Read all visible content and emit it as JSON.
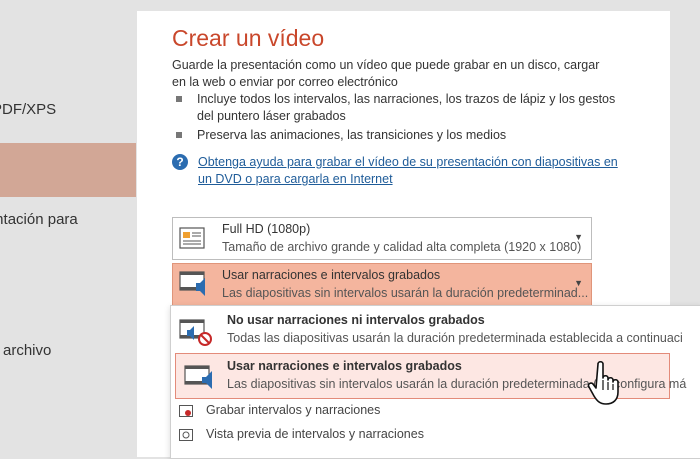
{
  "nav": {
    "items": [
      {
        "label": "PDF/XPS"
      },
      {
        "label": "Presentación para"
      },
      {
        "label": "archivo"
      }
    ]
  },
  "panel": {
    "title": "Crear un vídeo",
    "description": "Guarde la presentación como un vídeo que puede grabar en un disco, cargar en la web o enviar por correo electrónico",
    "bullets": [
      "Incluye todos los intervalos, las narraciones, los trazos de lápiz y los gestos del puntero láser grabados",
      "Preserva las animaciones, las transiciones y los medios"
    ],
    "help_link": "Obtenga ayuda para grabar el vídeo de su presentación con diapositivas en un DVD o para cargarla en Internet"
  },
  "quality_dropdown": {
    "title": "Full HD (1080p)",
    "subtitle": "Tamaño de archivo grande y calidad alta completa (1920 x 1080)"
  },
  "narration_dropdown": {
    "title": "Usar narraciones e intervalos grabados",
    "subtitle": "Las diapositivas sin intervalos usarán la duración predeterminad..."
  },
  "narration_options": [
    {
      "title": "No usar narraciones ni intervalos grabados",
      "subtitle": "Todas las diapositivas usarán la duración predeterminada establecida a continuaci"
    },
    {
      "title": "Usar narraciones e intervalos grabados",
      "subtitle": "Las diapositivas sin intervalos usarán la duración predeterminada (se configura má"
    }
  ],
  "narration_actions": [
    {
      "label": "Grabar intervalos y narraciones"
    },
    {
      "label": "Vista previa de intervalos y narraciones"
    }
  ],
  "colors": {
    "accent": "#c9472b",
    "nav_active": "#d2a796",
    "dropdown_highlight": "#f4b59e",
    "link": "#1f5c99"
  }
}
